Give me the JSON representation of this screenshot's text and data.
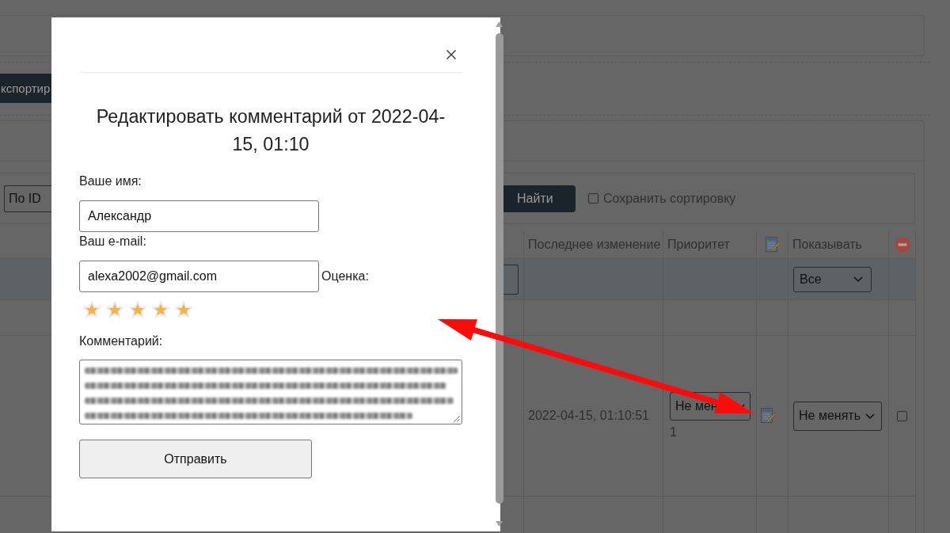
{
  "page": {
    "toolbar": {
      "export_button": "кспортир"
    },
    "filter_bar": {
      "sort_select": "По ID",
      "find_button": "Найти",
      "save_sort": {
        "label": "Сохранить сортировку",
        "checked": false
      }
    },
    "table": {
      "columns": [
        {
          "kind": "text",
          "label": "Последнее изменение"
        },
        {
          "kind": "text",
          "label": "Приоритет"
        },
        {
          "kind": "edit"
        },
        {
          "kind": "text",
          "label": "Показывать"
        },
        {
          "kind": "delete"
        }
      ],
      "filter_row": {
        "show_select": "Все"
      },
      "rows": [
        {
          "last_modified": "2022-04-15, 01:10:51",
          "priority_select": "Не мен",
          "priority": "1",
          "show_select": "Не менять",
          "checked": false
        }
      ]
    }
  },
  "modal": {
    "title": "Редактировать комментарий от 2022-04-15, 01:10",
    "fields": [
      {
        "label": "Ваше имя:",
        "value": "Александр"
      },
      {
        "label": "Ваш e-mail:",
        "value": "alexa2002@gmail.com"
      }
    ],
    "rating": {
      "label": "Оценка:",
      "stars": 5
    },
    "comment": {
      "label": "Комментарий:"
    },
    "submit_button": "Отправить"
  }
}
